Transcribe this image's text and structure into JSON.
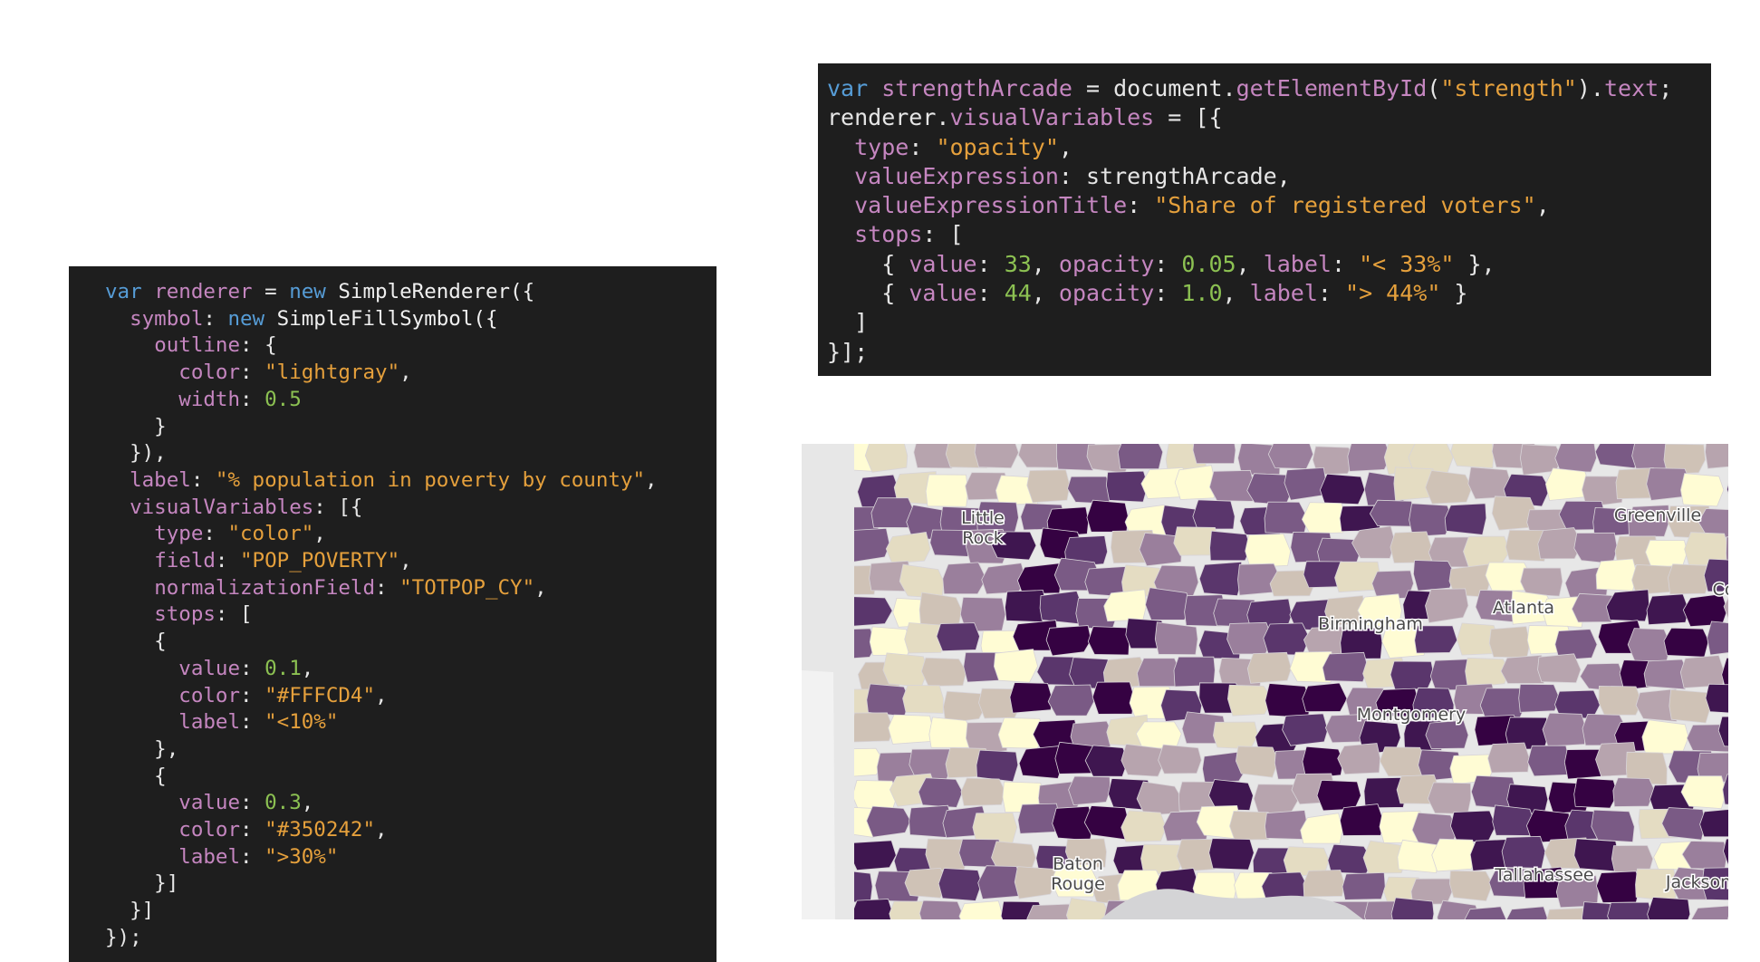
{
  "left_code": {
    "lines": [
      [
        [
          "kw",
          "var "
        ],
        [
          "vr",
          "renderer"
        ],
        [
          "pn",
          " = "
        ],
        [
          "kw",
          "new "
        ],
        [
          "fn",
          "SimpleRenderer({"
        ]
      ],
      [
        [
          "pn",
          "  "
        ],
        [
          "pr",
          "symbol"
        ],
        [
          "pn",
          ": "
        ],
        [
          "kw",
          "new "
        ],
        [
          "fn",
          "SimpleFillSymbol({"
        ]
      ],
      [
        [
          "pn",
          "    "
        ],
        [
          "pr",
          "outline"
        ],
        [
          "pn",
          ": {"
        ]
      ],
      [
        [
          "pn",
          "      "
        ],
        [
          "pr",
          "color"
        ],
        [
          "pn",
          ": "
        ],
        [
          "st",
          "\"lightgray\""
        ],
        [
          "pn",
          ","
        ]
      ],
      [
        [
          "pn",
          "      "
        ],
        [
          "pr",
          "width"
        ],
        [
          "pn",
          ": "
        ],
        [
          "nm",
          "0.5"
        ]
      ],
      [
        [
          "pn",
          "    }"
        ]
      ],
      [
        [
          "pn",
          "  }),"
        ]
      ],
      [
        [
          "pn",
          "  "
        ],
        [
          "pr",
          "label"
        ],
        [
          "pn",
          ": "
        ],
        [
          "st",
          "\"% population in poverty by county\""
        ],
        [
          "pn",
          ","
        ]
      ],
      [
        [
          "pn",
          "  "
        ],
        [
          "pr",
          "visualVariables"
        ],
        [
          "pn",
          ": [{"
        ]
      ],
      [
        [
          "pn",
          "    "
        ],
        [
          "pr",
          "type"
        ],
        [
          "pn",
          ": "
        ],
        [
          "st",
          "\"color\""
        ],
        [
          "pn",
          ","
        ]
      ],
      [
        [
          "pn",
          "    "
        ],
        [
          "pr",
          "field"
        ],
        [
          "pn",
          ": "
        ],
        [
          "st",
          "\"POP_POVERTY\""
        ],
        [
          "pn",
          ","
        ]
      ],
      [
        [
          "pn",
          "    "
        ],
        [
          "pr",
          "normalizationField"
        ],
        [
          "pn",
          ": "
        ],
        [
          "st",
          "\"TOTPOP_CY\""
        ],
        [
          "pn",
          ","
        ]
      ],
      [
        [
          "pn",
          "    "
        ],
        [
          "pr",
          "stops"
        ],
        [
          "pn",
          ": ["
        ]
      ],
      [
        [
          "pn",
          "    {"
        ]
      ],
      [
        [
          "pn",
          "      "
        ],
        [
          "pr",
          "value"
        ],
        [
          "pn",
          ": "
        ],
        [
          "nm",
          "0.1"
        ],
        [
          "pn",
          ","
        ]
      ],
      [
        [
          "pn",
          "      "
        ],
        [
          "pr",
          "color"
        ],
        [
          "pn",
          ": "
        ],
        [
          "st",
          "\"#FFFCD4\""
        ],
        [
          "pn",
          ","
        ]
      ],
      [
        [
          "pn",
          "      "
        ],
        [
          "pr",
          "label"
        ],
        [
          "pn",
          ": "
        ],
        [
          "st",
          "\"<10%\""
        ]
      ],
      [
        [
          "pn",
          "    },"
        ]
      ],
      [
        [
          "pn",
          "    {"
        ]
      ],
      [
        [
          "pn",
          "      "
        ],
        [
          "pr",
          "value"
        ],
        [
          "pn",
          ": "
        ],
        [
          "nm",
          "0.3"
        ],
        [
          "pn",
          ","
        ]
      ],
      [
        [
          "pn",
          "      "
        ],
        [
          "pr",
          "color"
        ],
        [
          "pn",
          ": "
        ],
        [
          "st",
          "\"#350242\""
        ],
        [
          "pn",
          ","
        ]
      ],
      [
        [
          "pn",
          "      "
        ],
        [
          "pr",
          "label"
        ],
        [
          "pn",
          ": "
        ],
        [
          "st",
          "\">30%\""
        ]
      ],
      [
        [
          "pn",
          "    }]"
        ]
      ],
      [
        [
          "pn",
          "  }]"
        ]
      ],
      [
        [
          "pn",
          "});"
        ]
      ]
    ]
  },
  "top_code": {
    "lines": [
      [
        [
          "kw",
          "var "
        ],
        [
          "vr",
          "strengthArcade"
        ],
        [
          "pn",
          " = document."
        ],
        [
          "vr",
          "getElementById"
        ],
        [
          "pn",
          "("
        ],
        [
          "st",
          "\"strength\""
        ],
        [
          "pn",
          ")."
        ],
        [
          "vr",
          "text"
        ],
        [
          "pn",
          ";"
        ]
      ],
      [
        [
          "pn",
          "renderer."
        ],
        [
          "vr",
          "visualVariables"
        ],
        [
          "pn",
          " = [{"
        ]
      ],
      [
        [
          "pn",
          "  "
        ],
        [
          "pr",
          "type"
        ],
        [
          "pn",
          ": "
        ],
        [
          "st",
          "\"opacity\""
        ],
        [
          "pn",
          ","
        ]
      ],
      [
        [
          "pn",
          "  "
        ],
        [
          "pr",
          "valueExpression"
        ],
        [
          "pn",
          ": strengthArcade,"
        ]
      ],
      [
        [
          "pn",
          "  "
        ],
        [
          "pr",
          "valueExpressionTitle"
        ],
        [
          "pn",
          ": "
        ],
        [
          "st",
          "\"Share of registered voters\""
        ],
        [
          "pn",
          ","
        ]
      ],
      [
        [
          "pn",
          "  "
        ],
        [
          "pr",
          "stops"
        ],
        [
          "pn",
          ": ["
        ]
      ],
      [
        [
          "pn",
          "    { "
        ],
        [
          "pr",
          "value"
        ],
        [
          "pn",
          ": "
        ],
        [
          "nm",
          "33"
        ],
        [
          "pn",
          ", "
        ],
        [
          "pr",
          "opacity"
        ],
        [
          "pn",
          ": "
        ],
        [
          "nm",
          "0.05"
        ],
        [
          "pn",
          ", "
        ],
        [
          "pr",
          "label"
        ],
        [
          "pn",
          ": "
        ],
        [
          "st",
          "\"< 33%\""
        ],
        [
          "pn",
          " },"
        ]
      ],
      [
        [
          "pn",
          "    { "
        ],
        [
          "pr",
          "value"
        ],
        [
          "pn",
          ": "
        ],
        [
          "nm",
          "44"
        ],
        [
          "pn",
          ", "
        ],
        [
          "pr",
          "opacity"
        ],
        [
          "pn",
          ": "
        ],
        [
          "nm",
          "1.0"
        ],
        [
          "pn",
          ", "
        ],
        [
          "pr",
          "label"
        ],
        [
          "pn",
          ": "
        ],
        [
          "st",
          "\"> 44%\""
        ],
        [
          "pn",
          " }"
        ]
      ],
      [
        [
          "pn",
          "  ]"
        ]
      ],
      [
        [
          "pn",
          "}];"
        ]
      ]
    ]
  },
  "map": {
    "palette": [
      "#fffcd4",
      "#e4dcc2",
      "#cfc2b6",
      "#b7a4ae",
      "#9a7f9c",
      "#7a5a85",
      "#5a366c",
      "#3f1650",
      "#350242"
    ],
    "water_color": "#d4d4d6",
    "background_color": "#e7e7e7",
    "cities": [
      "Little Rock",
      "Greenville",
      "Atlanta",
      "Birmingham",
      "Montgomery",
      "Baton Rouge",
      "Tallahassee",
      "Jackson",
      "Co"
    ]
  }
}
